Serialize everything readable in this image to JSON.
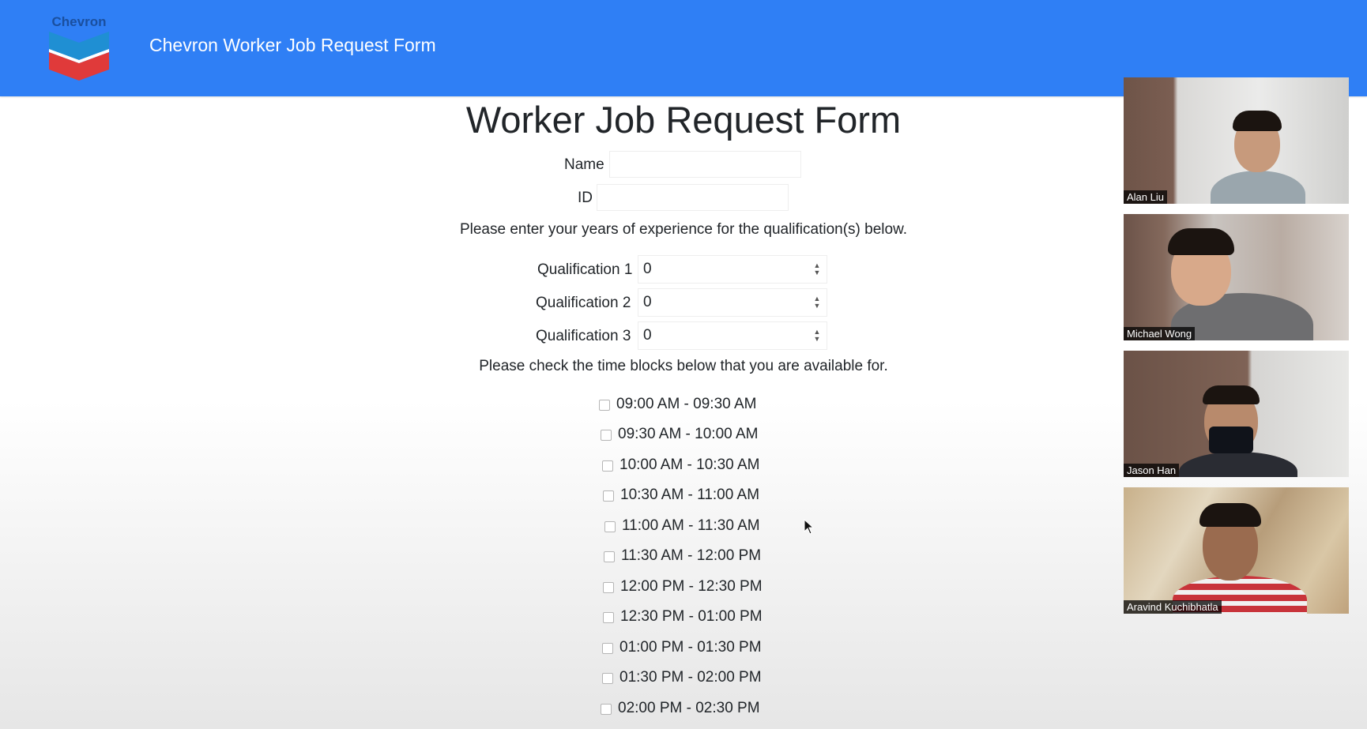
{
  "navbar": {
    "logo_text": "Chevron",
    "title": "Chevron Worker Job Request Form",
    "color": "#2f7ff5"
  },
  "form": {
    "title": "Worker Job Request Form",
    "name_label": "Name",
    "name_value": "",
    "id_label": "ID",
    "id_value": "",
    "experience_prompt": "Please enter your years of experience for the qualification(s) below.",
    "qualifications": [
      {
        "label": "Qualification 1",
        "value": "0"
      },
      {
        "label": "Qualification 2",
        "value": "0"
      },
      {
        "label": "Qualification 3",
        "value": "0"
      }
    ],
    "availability_prompt": "Please check the time blocks below that you are available for.",
    "time_blocks": [
      {
        "label": "09:00 AM - 09:30 AM",
        "checked": false
      },
      {
        "label": "09:30 AM - 10:00 AM",
        "checked": false
      },
      {
        "label": "10:00 AM - 10:30 AM",
        "checked": false
      },
      {
        "label": "10:30 AM - 11:00 AM",
        "checked": false
      },
      {
        "label": "11:00 AM - 11:30 AM",
        "checked": false
      },
      {
        "label": "11:30 AM - 12:00 PM",
        "checked": false
      },
      {
        "label": "12:00 PM - 12:30 PM",
        "checked": false
      },
      {
        "label": "12:30 PM - 01:00 PM",
        "checked": false
      },
      {
        "label": "01:00 PM - 01:30 PM",
        "checked": false
      },
      {
        "label": "01:30 PM - 02:00 PM",
        "checked": false
      },
      {
        "label": "02:00 PM - 02:30 PM",
        "checked": false
      }
    ]
  },
  "participants": [
    {
      "name": "Alan Liu"
    },
    {
      "name": "Michael Wong"
    },
    {
      "name": "Jason Han"
    },
    {
      "name": "Aravind Kuchibhatla"
    }
  ],
  "icons": {
    "logo": "chevron-logo-icon",
    "spinner": "spinner-arrows-icon",
    "cursor": "mouse-cursor-icon"
  }
}
